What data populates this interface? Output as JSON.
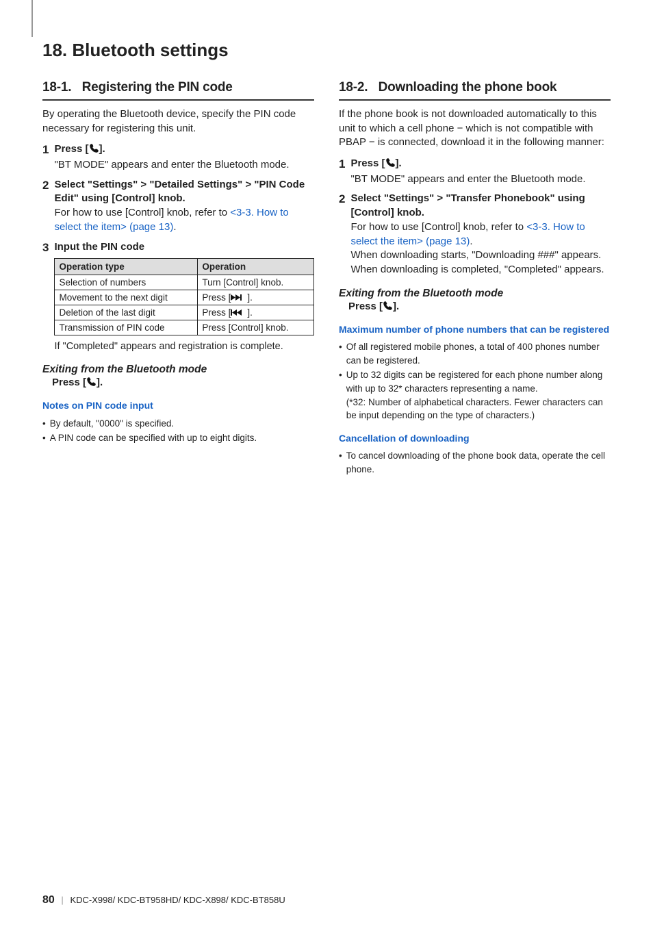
{
  "chapter": {
    "num": "18.",
    "title": "Bluetooth settings"
  },
  "left": {
    "sec_num": "18-1.",
    "sec_title": "Registering the PIN code",
    "intro": "By operating the Bluetooth device, specify the PIN code necessary for registering this unit.",
    "steps": {
      "s1": {
        "num": "1",
        "title_a": "Press [",
        "title_b": "].",
        "text": "\"BT MODE\" appears and enter the Bluetooth mode."
      },
      "s2": {
        "num": "2",
        "title_a": "Select \"Settings\" ",
        "gt1": ">",
        "title_b": " \"Detailed Settings\" ",
        "gt2": ">",
        "title_c": " \"PIN Code Edit\" using [Control] knob.",
        "text_a": "For how to use [Control] knob, refer to ",
        "link": "<3-3. How to select the item> (page 13)",
        "text_b": "."
      },
      "s3": {
        "num": "3",
        "title": "Input the PIN code"
      }
    },
    "table": {
      "h1": "Operation type",
      "h2": "Operation",
      "rows": [
        {
          "c1": "Selection of numbers",
          "c2": "Turn [Control] knob."
        },
        {
          "c1": "Movement to the next digit",
          "c2_a": "Press [",
          "c2_b": "]."
        },
        {
          "c1": "Deletion of the last digit",
          "c2_a": "Press [",
          "c2_b": "]."
        },
        {
          "c1": "Transmission of PIN code",
          "c2": "Press [Control] knob."
        }
      ]
    },
    "tbl_caption": "If \"Completed\" appears and registration is complete.",
    "exit_h": "Exiting from the Bluetooth mode",
    "exit_t_a": "Press [",
    "exit_t_b": "].",
    "note_h": "Notes on PIN code input",
    "notes": [
      "By default, \"0000\" is specified.",
      "A PIN code can be specified with up to eight digits."
    ]
  },
  "right": {
    "sec_num": "18-2.",
    "sec_title": "Downloading the phone book",
    "intro": "If the phone book is not downloaded automatically to this unit to which a cell phone − which is not compatible with PBAP − is connected, download it in the following manner:",
    "steps": {
      "s1": {
        "num": "1",
        "title_a": "Press [",
        "title_b": "].",
        "text": "\"BT MODE\" appears and enter the Bluetooth mode."
      },
      "s2": {
        "num": "2",
        "title_a": "Select \"Settings\" ",
        "gt1": ">",
        "title_b": " \"Transfer Phonebook\" using [Control] knob.",
        "text_a": "For how to use [Control] knob, refer to ",
        "link": "<3-3. How to select the item> (page 13)",
        "text_b": ".",
        "text2": "When downloading starts, \"Downloading ###\" appears.",
        "text3": "When downloading is completed, \"Completed\" appears."
      }
    },
    "exit_h": "Exiting from the Bluetooth mode",
    "exit_t_a": "Press [",
    "exit_t_b": "].",
    "note_h": "Maximum number of phone numbers that can be registered",
    "notes": [
      "Of all registered mobile phones, a total of 400 phones number can be registered.",
      "Up to 32 digits can be registered for each phone number along with up to 32* characters representing a name.\n(*32: Number of alphabetical characters. Fewer characters can be input depending on the type of characters.)"
    ],
    "note2_h": "Cancellation of downloading",
    "notes2": [
      "To cancel downloading of the phone book data, operate the cell phone."
    ]
  },
  "footer": {
    "page": "80",
    "models": "KDC-X998/ KDC-BT958HD/ KDC-X898/ KDC-BT858U"
  }
}
